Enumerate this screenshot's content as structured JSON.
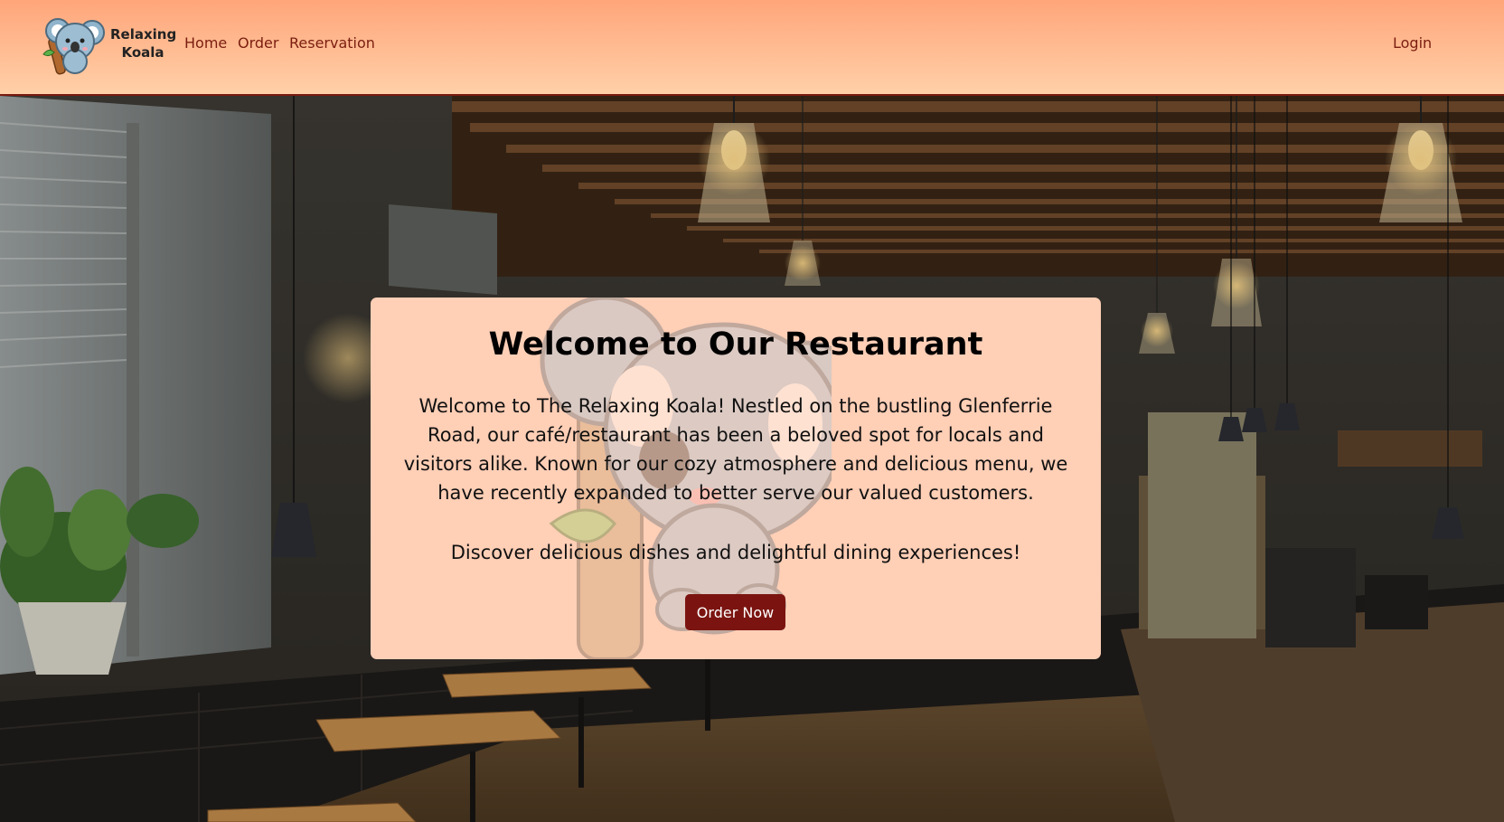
{
  "navbar": {
    "brand_line1": "Relaxing",
    "brand_line2": "Koala",
    "logo_icon": "koala-logo-icon",
    "links": [
      {
        "label": "Home"
      },
      {
        "label": "Order"
      },
      {
        "label": "Reservation"
      }
    ],
    "login_label": "Login"
  },
  "hero": {
    "background_icon": "restaurant-interior-photo",
    "title": "Welcome to Our Restaurant",
    "body": "Welcome to The Relaxing Koala! Nestled on the bustling Glenferrie Road, our café/restaurant has been a beloved spot for locals and visitors alike. Known for our cozy atmosphere and delicious menu, we have recently expanded to better serve our valued customers.",
    "tagline": "Discover delicious dishes and delightful dining experiences!",
    "cta_label": "Order Now"
  },
  "colors": {
    "header_top": "#ffa57a",
    "header_bottom": "#ffd0a8",
    "nav_link": "#7a1e10",
    "card_bg": "#ffcfb6",
    "button_bg": "#7b1410"
  }
}
